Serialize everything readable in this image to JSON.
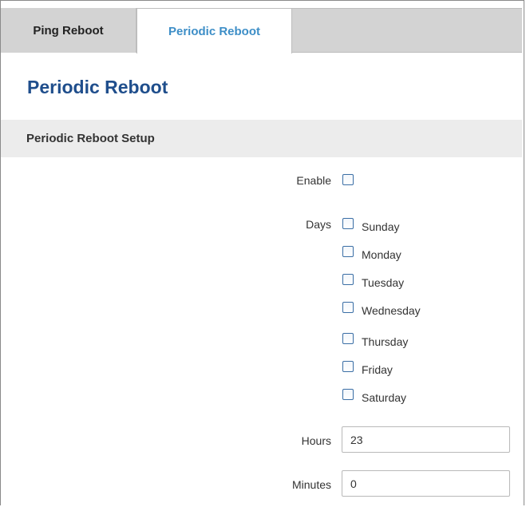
{
  "tabs": [
    {
      "label": "Ping Reboot",
      "active": false
    },
    {
      "label": "Periodic Reboot",
      "active": true
    }
  ],
  "page_title": "Periodic Reboot",
  "section_title": "Periodic Reboot Setup",
  "form": {
    "enable": {
      "label": "Enable",
      "checked": false
    },
    "days": {
      "label": "Days",
      "options": [
        {
          "label": "Sunday",
          "checked": false
        },
        {
          "label": "Monday",
          "checked": false
        },
        {
          "label": "Tuesday",
          "checked": false
        },
        {
          "label": "Wednesday",
          "checked": false
        },
        {
          "label": "Thursday",
          "checked": false
        },
        {
          "label": "Friday",
          "checked": false
        },
        {
          "label": "Saturday",
          "checked": false
        }
      ]
    },
    "hours": {
      "label": "Hours",
      "value": "23"
    },
    "minutes": {
      "label": "Minutes",
      "value": "0"
    }
  },
  "colors": {
    "active_tab_text": "#3d8ec7",
    "page_title": "#1f4e8c",
    "tab_bar_bg": "#d3d3d3",
    "section_bg": "#ececec",
    "checkbox_border": "#3a6ea5"
  }
}
